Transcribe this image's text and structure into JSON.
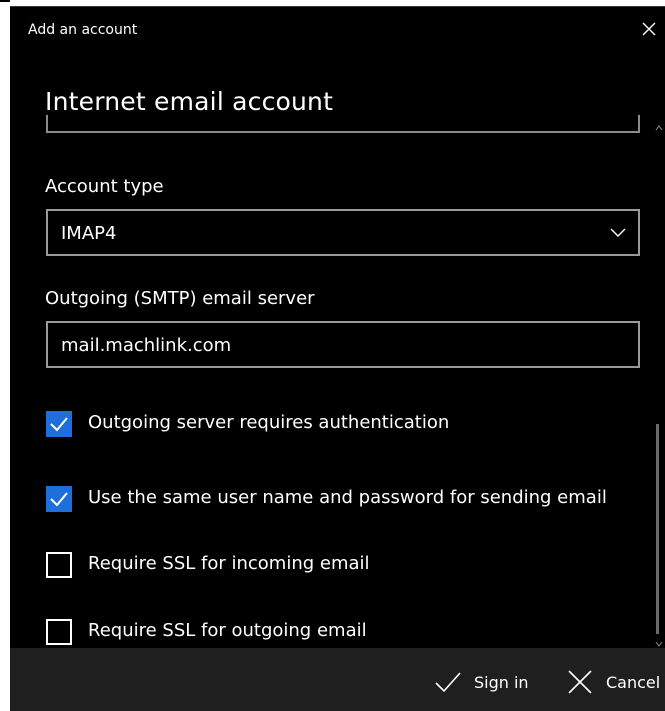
{
  "window": {
    "title": "Add an account"
  },
  "heading": "Internet email account",
  "account_type": {
    "label": "Account type",
    "value": "IMAP4"
  },
  "smtp": {
    "label": "Outgoing (SMTP) email server",
    "value": "mail.machlink.com"
  },
  "options": [
    {
      "label": "Outgoing server requires authentication",
      "checked": true
    },
    {
      "label": "Use the same user name and password for sending email",
      "checked": true
    },
    {
      "label": "Require SSL for incoming email",
      "checked": false
    },
    {
      "label": "Require SSL for outgoing email",
      "checked": false
    }
  ],
  "footer": {
    "signin_label": "Sign in",
    "cancel_label": "Cancel"
  },
  "colors": {
    "accent": "#1e6fdc",
    "background": "#000000",
    "footer": "#1f1f1f",
    "text": "#ffffff"
  },
  "icons": {
    "close": "close-icon",
    "chevron": "chevron-down-icon",
    "check": "check-icon",
    "signin": "checkmark-icon",
    "cancel": "x-icon"
  }
}
